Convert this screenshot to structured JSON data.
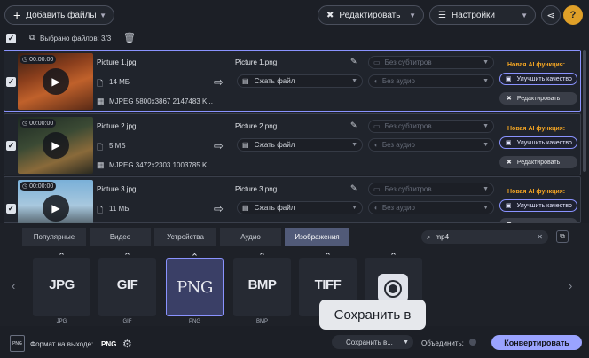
{
  "toolbar": {
    "add_files": "Добавить файлы",
    "edit": "Редактировать",
    "settings": "Настройки",
    "help": "?"
  },
  "selection": {
    "label": "Выбрано файлов: 3/3"
  },
  "files": [
    {
      "duration": "00:00:00",
      "source": "Picture 1.jpg",
      "size": "14 МБ",
      "meta": "MJPEG 5800x3867 2147483 K...",
      "output": "Picture 1.png",
      "compress": "Сжать файл",
      "subtitles": "Без субтитров",
      "audio": "Без аудио",
      "ai_label": "Новая AI функция:",
      "improve": "Улучшить качество",
      "edit": "Редактировать"
    },
    {
      "duration": "00:00:00",
      "source": "Picture 2.jpg",
      "size": "5 МБ",
      "meta": "MJPEG 3472x2303 1003785 K...",
      "output": "Picture 2.png",
      "compress": "Сжать файл",
      "subtitles": "Без субтитров",
      "audio": "Без аудио",
      "ai_label": "Новая AI функция:",
      "improve": "Улучшить качество",
      "edit": "Редактировать"
    },
    {
      "duration": "00:00:00",
      "source": "Picture 3.jpg",
      "size": "11 МБ",
      "meta": "",
      "output": "Picture 3.png",
      "compress": "Сжать файл",
      "subtitles": "Без субтитров",
      "audio": "Без аудио",
      "ai_label": "Новая AI функция:",
      "improve": "Улучшить качество",
      "edit": ""
    }
  ],
  "tabs": [
    "Популярные",
    "Видео",
    "Устройства",
    "Аудио",
    "Изображения"
  ],
  "search": {
    "value": "mp4"
  },
  "formats": [
    {
      "tile": "JPG",
      "label": "JPG"
    },
    {
      "tile": "GIF",
      "label": "GIF"
    },
    {
      "tile": "PNG",
      "label": "PNG"
    },
    {
      "tile": "BMP",
      "label": "BMP"
    },
    {
      "tile": "TIFF",
      "label": ""
    },
    {
      "tile": "",
      "label": ""
    }
  ],
  "tooltip": "Сохранить в",
  "footer": {
    "format_label": "Формат на выходе:",
    "format_value": "PNG",
    "save_to": "Сохранить в...",
    "merge": "Объединить:",
    "convert": "Конвертировать",
    "format_icon": "PNG"
  },
  "colors": {
    "accent": "#8a93ff",
    "ai": "#f5a623",
    "convert": "#9aa3ff"
  }
}
